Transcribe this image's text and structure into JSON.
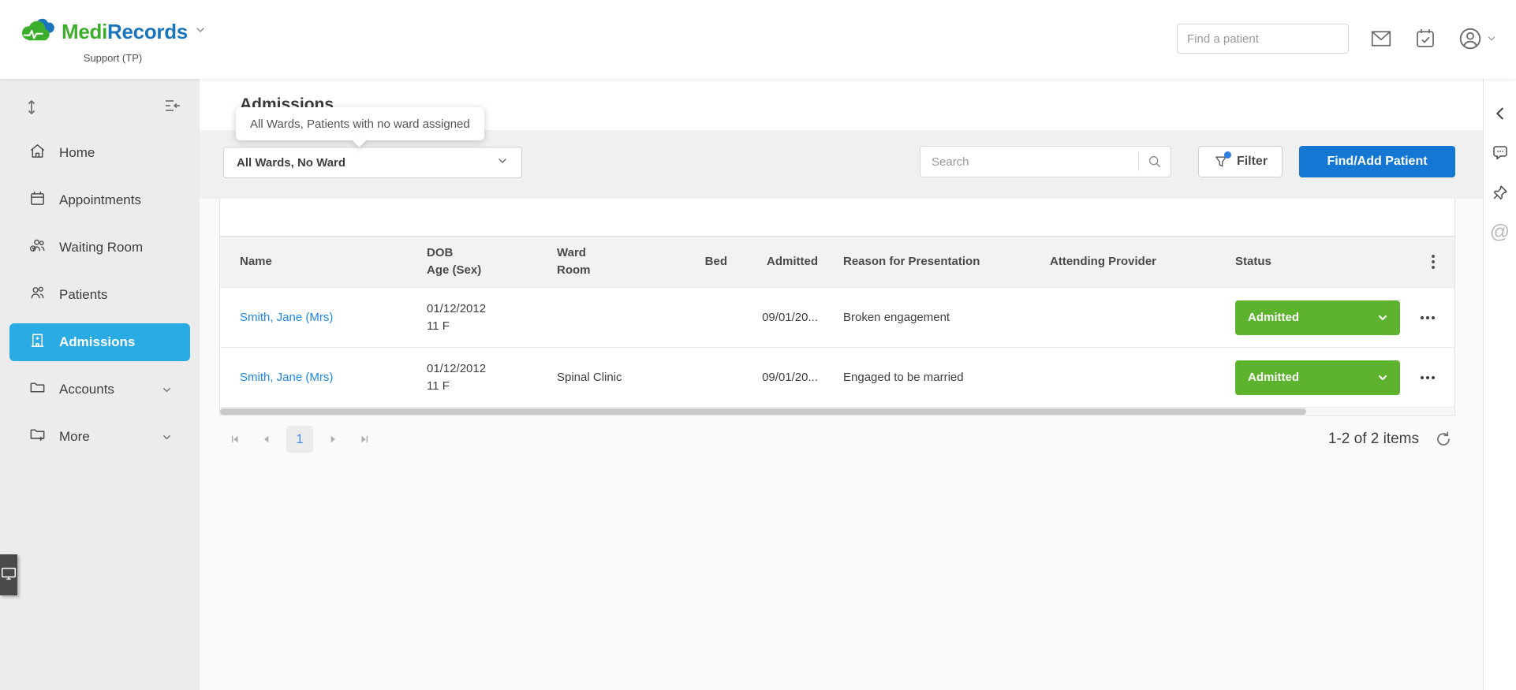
{
  "header": {
    "brand_part1": "Medi",
    "brand_part2": "Records",
    "account_label": "Support (TP)",
    "find_patient_placeholder": "Find a patient"
  },
  "sidebar": {
    "items": [
      {
        "label": "Home"
      },
      {
        "label": "Appointments"
      },
      {
        "label": "Waiting Room"
      },
      {
        "label": "Patients"
      },
      {
        "label": "Admissions"
      },
      {
        "label": "Accounts"
      },
      {
        "label": "More"
      }
    ]
  },
  "page": {
    "title": "Admissions",
    "tooltip": "All Wards, Patients with no ward assigned",
    "ward_filter_value": "All Wards, No Ward",
    "search_placeholder": "Search",
    "filter_label": "Filter",
    "find_add_patient_label": "Find/Add Patient"
  },
  "table": {
    "columns": [
      {
        "line1": "Name",
        "line2": ""
      },
      {
        "line1": "DOB",
        "line2": "Age (Sex)"
      },
      {
        "line1": "Ward",
        "line2": "Room"
      },
      {
        "line1": "Bed",
        "line2": ""
      },
      {
        "line1": "Admitted",
        "line2": ""
      },
      {
        "line1": "Reason for Presentation",
        "line2": ""
      },
      {
        "line1": "Attending Provider",
        "line2": ""
      },
      {
        "line1": "Status",
        "line2": ""
      }
    ],
    "rows": [
      {
        "name": "Smith, Jane (Mrs)",
        "dob": "01/12/2012",
        "age_sex": "11 F",
        "ward_room": "",
        "bed": "",
        "admitted": "09/01/20...",
        "reason": "Broken engagement",
        "attending_provider": "",
        "status": "Admitted"
      },
      {
        "name": "Smith, Jane (Mrs)",
        "dob": "01/12/2012",
        "age_sex": "11 F",
        "ward_room": "Spinal Clinic",
        "bed": "",
        "admitted": "09/01/20...",
        "reason": "Engaged to be married",
        "attending_provider": "",
        "status": "Admitted"
      }
    ]
  },
  "pagination": {
    "current_page": "1",
    "summary": "1-2 of 2 items"
  },
  "rail": {
    "at_symbol": "@"
  },
  "colors": {
    "brand_green": "#3dae2b",
    "brand_blue": "#1b75bb",
    "active_nav_blue": "#2aabe4",
    "primary_button_blue": "#1477d4",
    "status_green": "#5db32e",
    "link_blue": "#1e88e5",
    "page_number_blue": "#4a90f5",
    "filter_dot_blue": "#2a7de1"
  }
}
